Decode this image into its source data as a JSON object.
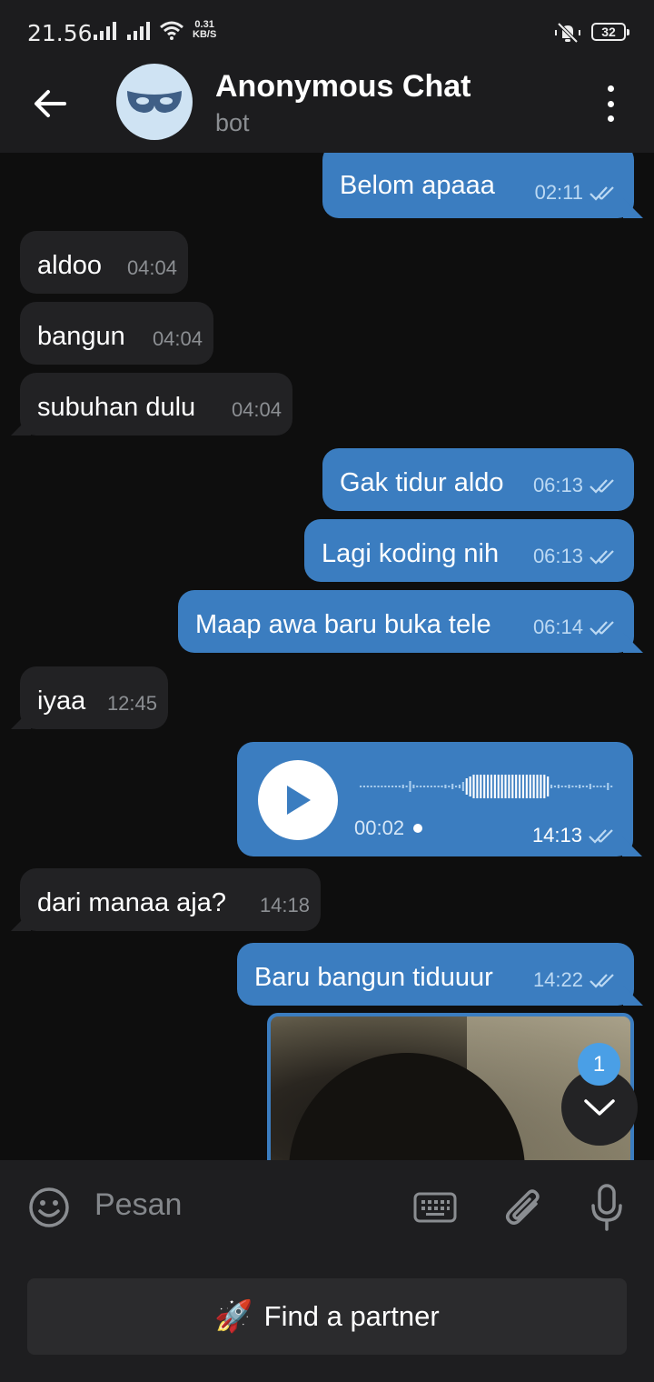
{
  "status_bar": {
    "time": "21.56",
    "net_speed_value": "0.31",
    "net_speed_unit": "KB/S",
    "battery": "32"
  },
  "header": {
    "title": "Anonymous Chat",
    "subtitle": "bot",
    "avatar_icon": "mask-icon",
    "accent": "#3b7dc0"
  },
  "messages": [
    {
      "dir": "out",
      "text": "Belom apaaa",
      "time": "02:11",
      "read": true
    },
    {
      "dir": "in",
      "text": "aldoo",
      "time": "04:04"
    },
    {
      "dir": "in",
      "text": "bangun",
      "time": "04:04"
    },
    {
      "dir": "in",
      "text": "subuhan dulu",
      "time": "04:04"
    },
    {
      "dir": "out",
      "text": "Gak tidur aldo",
      "time": "06:13",
      "read": true
    },
    {
      "dir": "out",
      "text": "Lagi koding nih",
      "time": "06:13",
      "read": true
    },
    {
      "dir": "out",
      "text": "Maap awa baru buka tele",
      "time": "06:14",
      "read": true
    },
    {
      "dir": "in",
      "text": "iyaa",
      "time": "12:45"
    },
    {
      "dir": "out",
      "type": "voice",
      "duration": "00:02",
      "time": "14:13",
      "read": true
    },
    {
      "dir": "in",
      "text": "dari manaa aja?",
      "time": "14:18"
    },
    {
      "dir": "out",
      "text": "Baru bangun tiduuur",
      "time": "14:22",
      "read": true
    },
    {
      "dir": "out",
      "type": "photo"
    }
  ],
  "scroll_down": {
    "unread_count": "1"
  },
  "composer": {
    "placeholder": "Pesan"
  },
  "bottom_button": {
    "emoji": "🚀",
    "label": "Find a partner"
  }
}
